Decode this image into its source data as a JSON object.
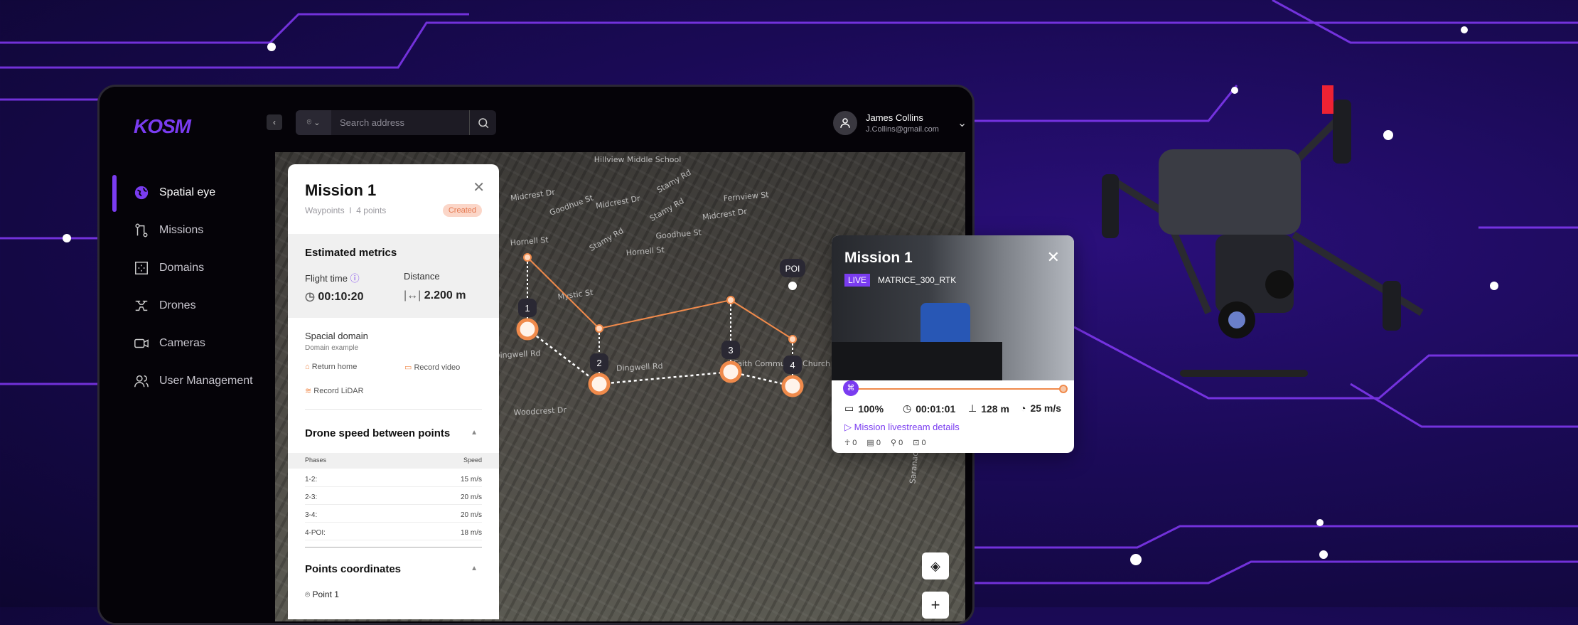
{
  "app": {
    "logo": "KOSM"
  },
  "sidebar": {
    "items": [
      {
        "label": "Spatial eye",
        "icon": "globe-icon",
        "active": true
      },
      {
        "label": "Missions",
        "icon": "route-icon"
      },
      {
        "label": "Domains",
        "icon": "domain-grid-icon"
      },
      {
        "label": "Drones",
        "icon": "drone-icon"
      },
      {
        "label": "Cameras",
        "icon": "camera-icon"
      },
      {
        "label": "User Management",
        "icon": "users-icon"
      }
    ]
  },
  "topbar": {
    "search_placeholder": "Search address",
    "user": {
      "name": "James Collins",
      "email": "J.Collins@gmail.com"
    }
  },
  "mission_panel": {
    "title": "Mission 1",
    "type": "Waypoints",
    "separator": "I",
    "points": "4 points",
    "status": "Created",
    "metrics_title": "Estimated metrics",
    "flight_time_label": "Flight time",
    "flight_time": "00:10:20",
    "distance_label": "Distance",
    "distance": "2.200 m",
    "domain_title": "Spacial domain",
    "domain_name": "Domain example",
    "actions": [
      "Return home",
      "Record video",
      "Record LiDAR"
    ],
    "speed_title": "Drone speed between points",
    "speed_headers": [
      "Phases",
      "Speed"
    ],
    "speeds": [
      {
        "phase": "1-2:",
        "speed": "15 m/s"
      },
      {
        "phase": "2-3:",
        "speed": "20 m/s"
      },
      {
        "phase": "3-4:",
        "speed": "20 m/s"
      },
      {
        "phase": "4-POI:",
        "speed": "18 m/s"
      }
    ],
    "coords_title": "Points coordinates",
    "first_point": "Point 1"
  },
  "map": {
    "labels": [
      "Hillview Middle School",
      "Midcrest Dr",
      "Goodhue St",
      "Midcrest Dr",
      "Stamy Rd",
      "Fernview St",
      "Midcrest Dr",
      "Stamy Rd",
      "Hornell St",
      "Stamy Rd",
      "Goodhue St",
      "Hornell St",
      "Mystic St",
      "Dingwell Rd",
      "Dingwell Rd",
      "Woodcrest Dr",
      "Saranac Dr",
      "Faith Community Church"
    ],
    "waypoints": [
      "1",
      "2",
      "3",
      "4"
    ],
    "poi": "POI",
    "accent": "#f08a4b"
  },
  "live_card": {
    "title": "Mission 1",
    "live": "LIVE",
    "drone": "MATRICE_300_RTK",
    "battery": "100%",
    "elapsed": "00:01:01",
    "altitude": "128 m",
    "speed": "25 m/s",
    "link": "Mission livestream details",
    "counts": [
      "0",
      "0",
      "0",
      "0"
    ],
    "progress": 1.0
  },
  "colors": {
    "brand": "#7a3cf0",
    "accent": "#f08a4b"
  }
}
